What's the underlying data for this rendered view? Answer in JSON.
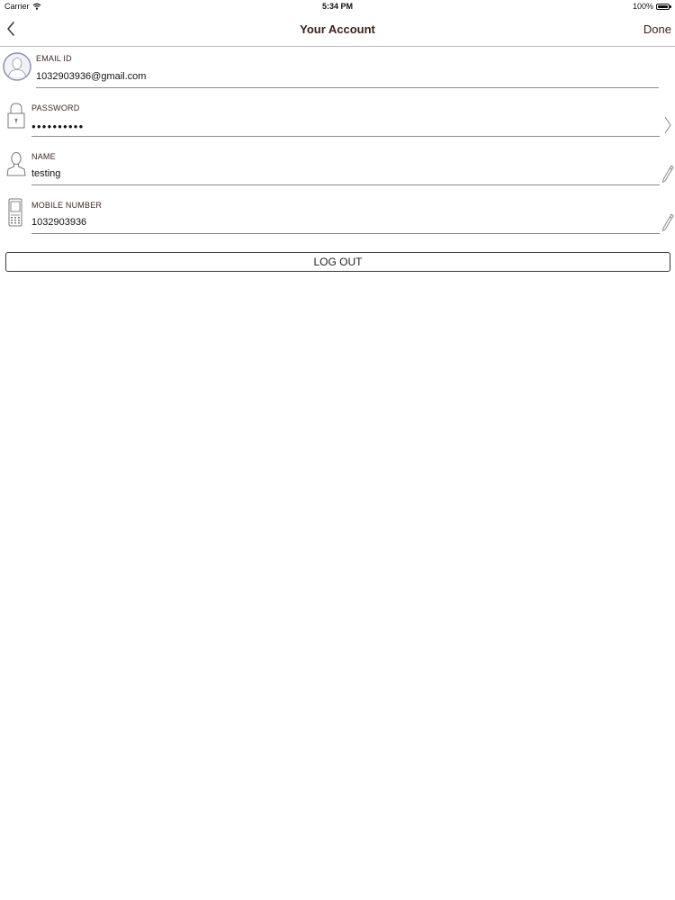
{
  "status_bar": {
    "carrier": "Carrier",
    "time": "5:34 PM",
    "battery": "100%"
  },
  "nav": {
    "title": "Your Account",
    "done_label": "Done"
  },
  "fields": {
    "email": {
      "label": "EMAIL ID",
      "value": "1032903936@gmail.com"
    },
    "password": {
      "label": "PASSWORD",
      "value": "●●●●●●●●●●"
    },
    "name": {
      "label": "NAME",
      "value": "testing"
    },
    "mobile": {
      "label": "MOBILE NUMBER",
      "value": "1032903936"
    }
  },
  "logout_label": "LOG OUT",
  "icons": {
    "avatar": "avatar-icon",
    "password": "lock-icon",
    "name": "person-icon",
    "mobile": "phone-icon",
    "chevron": "chevron-right-icon",
    "edit": "pencil-icon",
    "back": "chevron-left-icon",
    "wifi": "wifi-icon",
    "battery": "battery-icon"
  },
  "colors": {
    "title": "#3b1f1c",
    "divider": "#b9b9b9",
    "avatar_ring": "#8e8fb3"
  }
}
